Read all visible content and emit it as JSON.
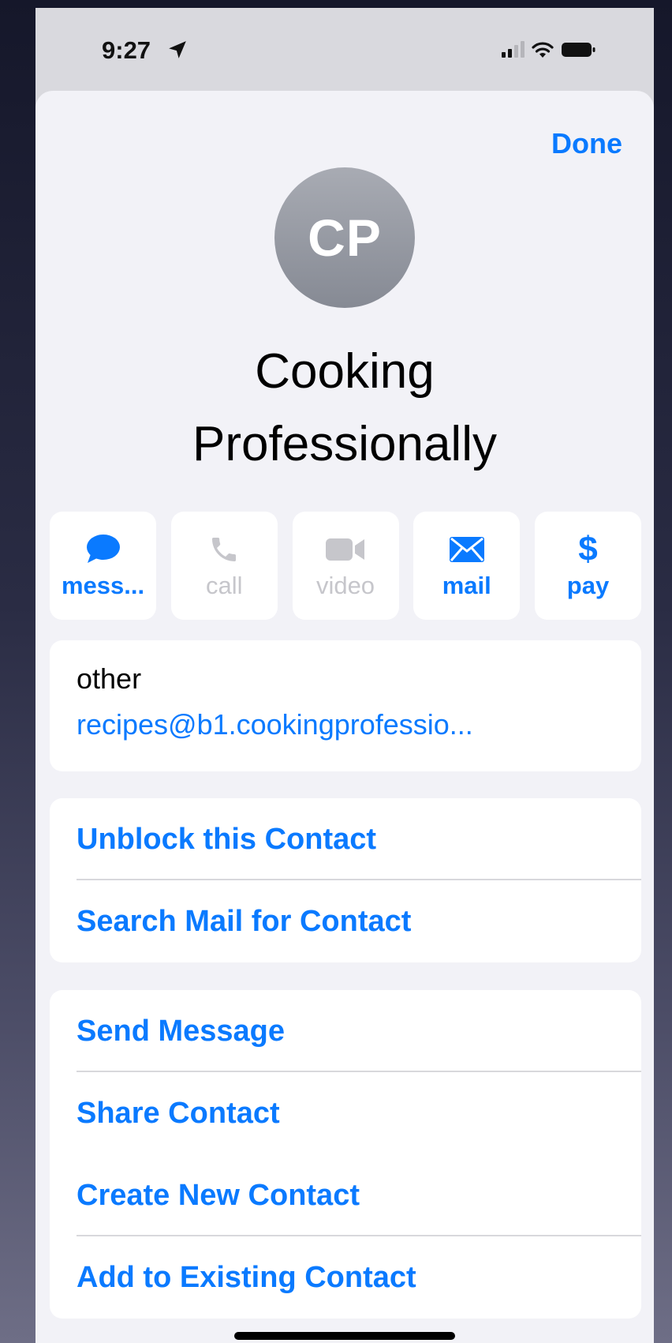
{
  "status_bar": {
    "time": "9:27"
  },
  "header": {
    "done_label": "Done"
  },
  "contact": {
    "initials": "CP",
    "name_line1": "Cooking",
    "name_line2": "Professionally"
  },
  "actions": [
    {
      "label": "mess...",
      "icon": "message-bubble-icon",
      "enabled": true
    },
    {
      "label": "call",
      "icon": "phone-icon",
      "enabled": false
    },
    {
      "label": "video",
      "icon": "video-camera-icon",
      "enabled": false
    },
    {
      "label": "mail",
      "icon": "envelope-icon",
      "enabled": true
    },
    {
      "label": "pay",
      "icon": "dollar-icon",
      "enabled": true
    }
  ],
  "email": {
    "type": "other",
    "value": "recipes@b1.cookingprofessio..."
  },
  "options_group_1": [
    {
      "label": "Unblock this Contact"
    },
    {
      "label": "Search Mail for Contact"
    }
  ],
  "options_group_2": [
    {
      "label": "Send Message"
    },
    {
      "label": "Share Contact"
    },
    {
      "label": "Create New Contact"
    },
    {
      "label": "Add to Existing Contact"
    }
  ],
  "colors": {
    "accent": "#0a7aff",
    "disabled": "#c6c6cb",
    "sheet_background": "#f2f2f7"
  }
}
